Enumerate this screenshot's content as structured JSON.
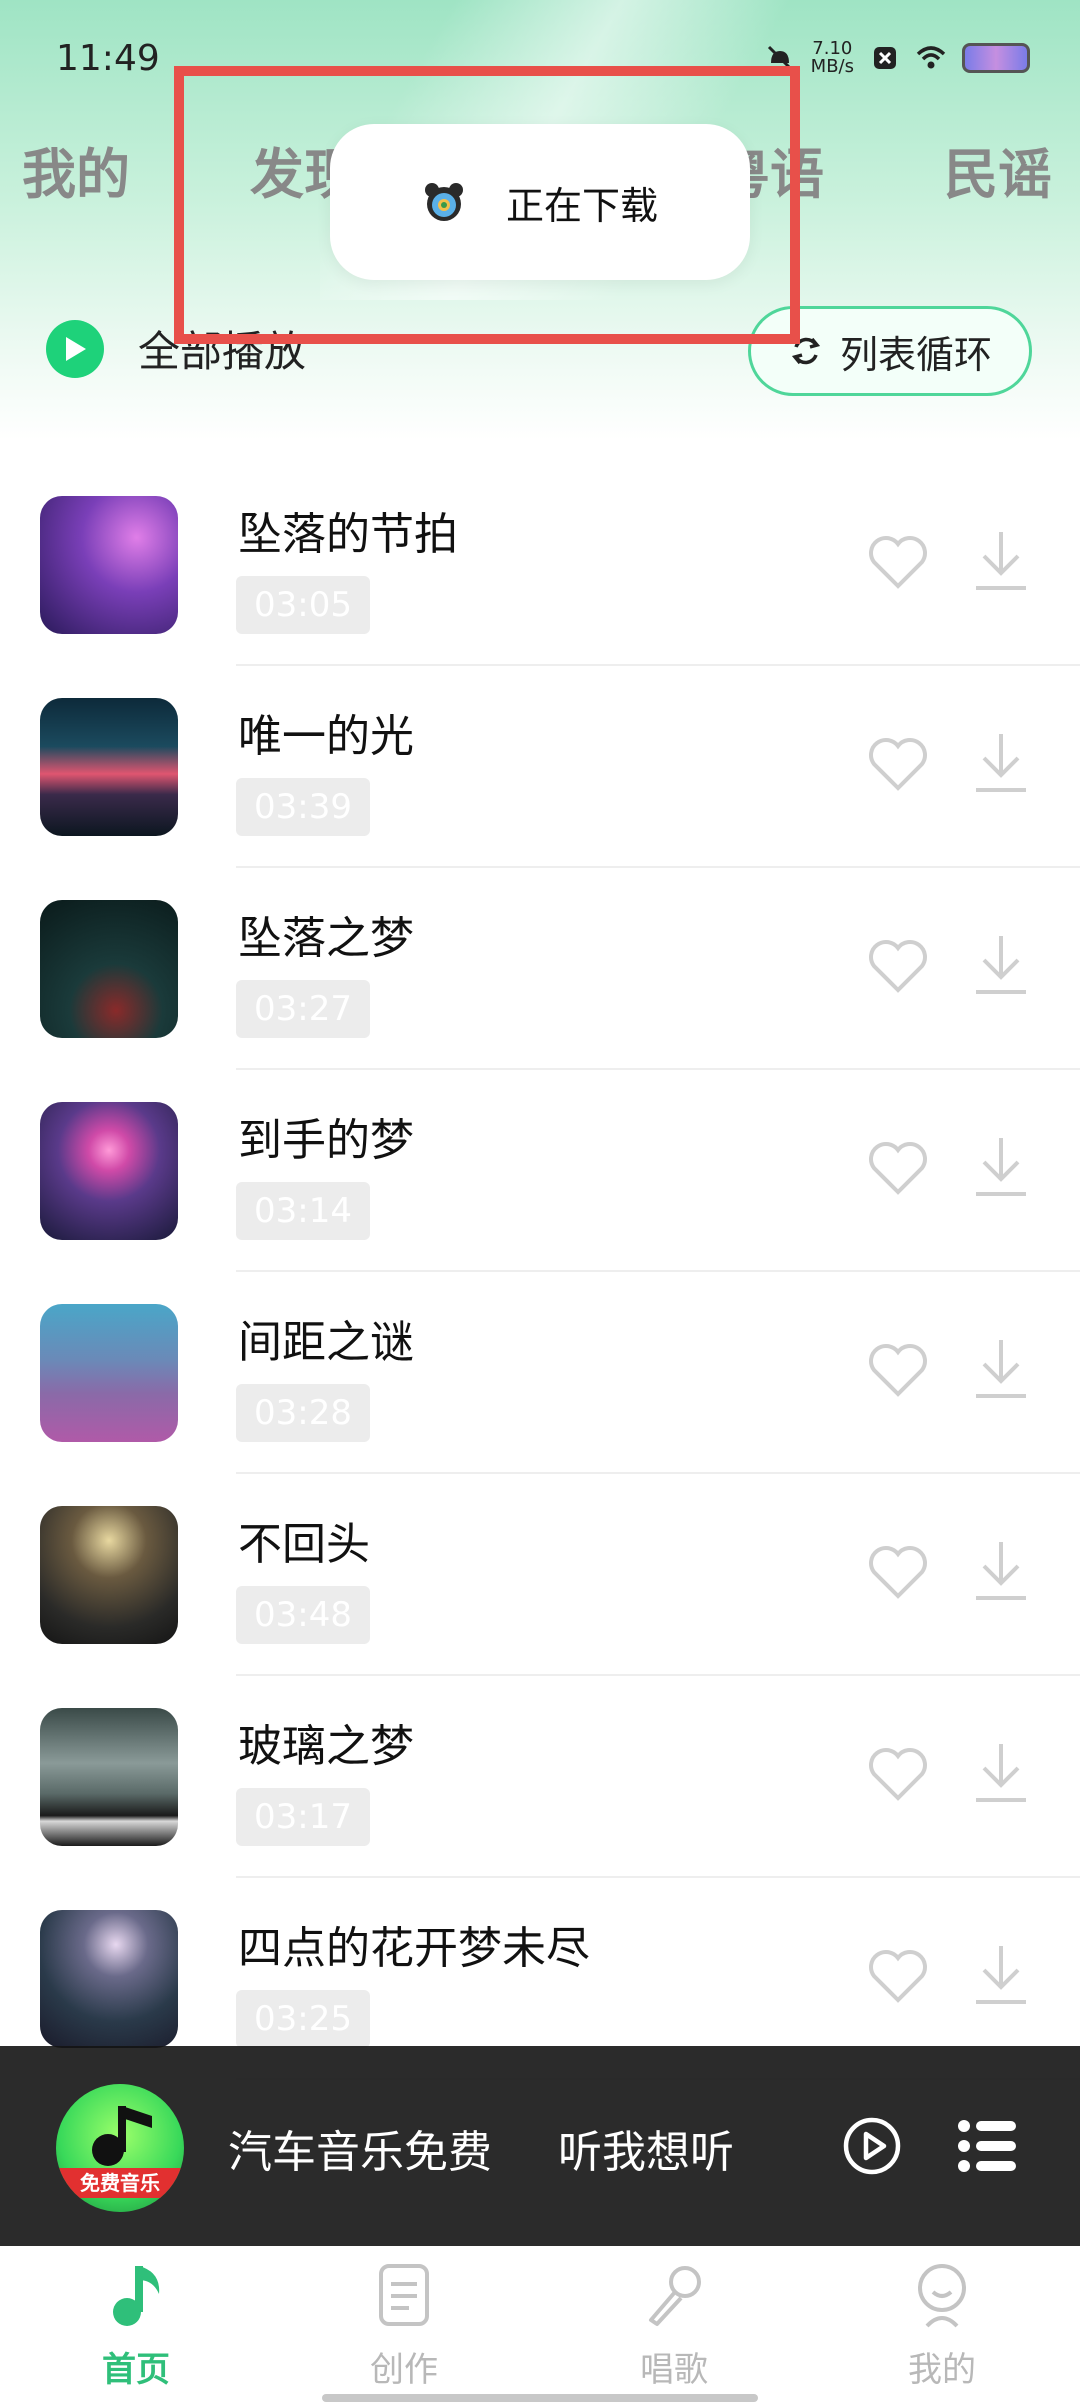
{
  "status_bar": {
    "time": "11:49",
    "speed_value": "7.10",
    "speed_unit": "MB/s"
  },
  "tabs": [
    "我的",
    "发现",
    "粤语",
    "民谣"
  ],
  "play_all_label": "全部播放",
  "loop_label": "列表循环",
  "toast": {
    "text": "正在下载"
  },
  "songs": [
    {
      "title": "坠落的节拍",
      "duration": "03:05"
    },
    {
      "title": "唯一的光",
      "duration": "03:39"
    },
    {
      "title": "坠落之梦",
      "duration": "03:27"
    },
    {
      "title": "到手的梦",
      "duration": "03:14"
    },
    {
      "title": "间距之谜",
      "duration": "03:28"
    },
    {
      "title": "不回头",
      "duration": "03:48"
    },
    {
      "title": "玻璃之梦",
      "duration": "03:17"
    },
    {
      "title": "四点的花开梦未尽",
      "duration": "03:25"
    }
  ],
  "mini_player": {
    "logo_text": "免费音乐",
    "text1": "汽车音乐免费",
    "text2": "听我想听"
  },
  "bottom_nav": [
    {
      "label": "首页",
      "icon": "music-note-icon"
    },
    {
      "label": "创作",
      "icon": "document-icon"
    },
    {
      "label": "唱歌",
      "icon": "microphone-icon"
    },
    {
      "label": "我的",
      "icon": "profile-icon"
    }
  ],
  "colors": {
    "accent": "#2fbf7a",
    "highlight": "#e8504a"
  }
}
